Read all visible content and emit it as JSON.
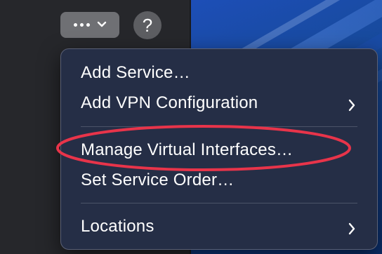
{
  "toolbar": {
    "more_button": "more-actions",
    "help_label": "?"
  },
  "menu": {
    "items": [
      {
        "label": "Add Service…",
        "submenu": false
      },
      {
        "label": "Add VPN Configuration",
        "submenu": true
      },
      {
        "label": "Manage Virtual Interfaces…",
        "submenu": false,
        "highlighted": true
      },
      {
        "label": "Set Service Order…",
        "submenu": false
      },
      {
        "label": "Locations",
        "submenu": true
      }
    ]
  },
  "annotation": {
    "shape": "ellipse",
    "color": "#e8344a",
    "target": "Manage Virtual Interfaces…"
  },
  "colors": {
    "menu_background": "#252e46",
    "button_background": "#6f7074",
    "wallpaper": "#174a9b"
  }
}
